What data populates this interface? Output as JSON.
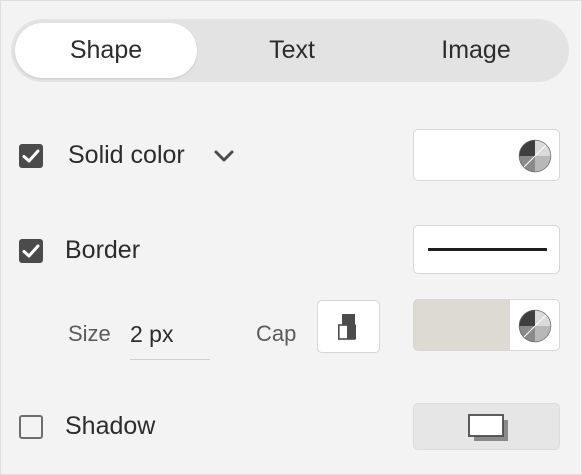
{
  "tabs": [
    {
      "label": "Shape",
      "active": true
    },
    {
      "label": "Text",
      "active": false
    },
    {
      "label": "Image",
      "active": false
    }
  ],
  "fill": {
    "label": "Solid color",
    "checked": true,
    "dropdown_icon": "chevron-down-icon",
    "color": "#ffffff"
  },
  "border": {
    "label": "Border",
    "checked": true,
    "color": "#dcdad2",
    "size_label": "Size",
    "size_value": "2 px",
    "cap_label": "Cap"
  },
  "shadow": {
    "label": "Shadow",
    "checked": false
  },
  "colors": {
    "accent_check": "#4b4b4b",
    "panel_bg": "#f3f3f3"
  }
}
